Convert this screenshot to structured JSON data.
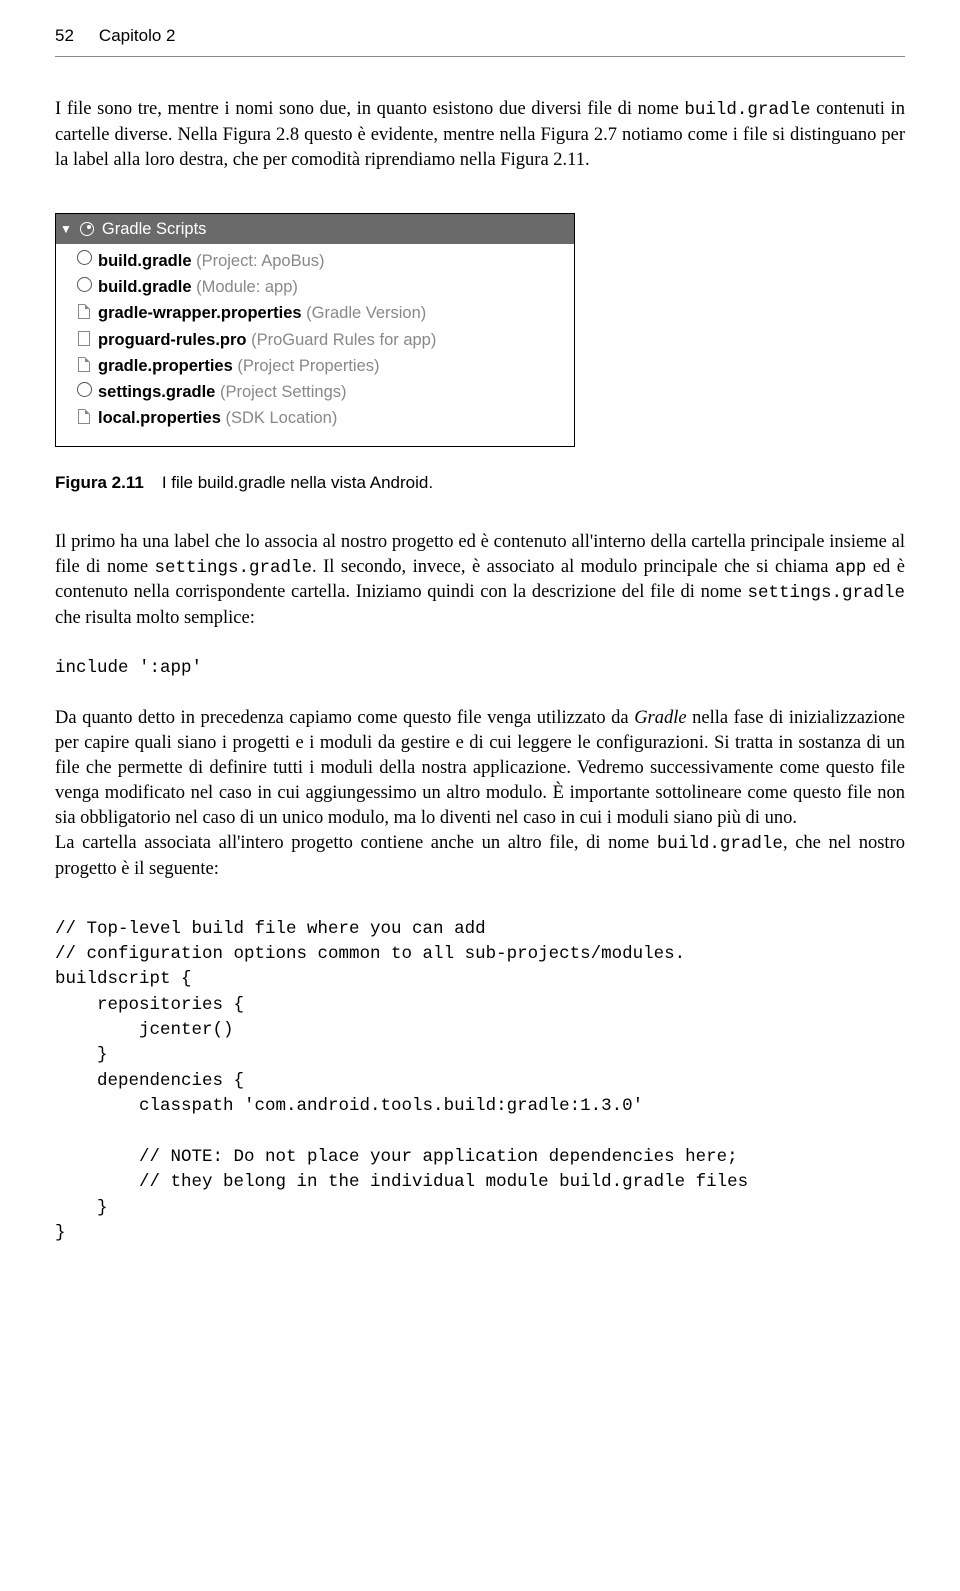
{
  "header": {
    "page": "52",
    "chapter": "Capitolo 2"
  },
  "para1_a": "I file sono tre, mentre i nomi sono due, in quanto esistono due diversi file di nome ",
  "para1_code1": "build.gradle",
  "para1_b": " contenuti in cartelle diverse. Nella Figura 2.8 questo è evidente, mentre nella Figura 2.7 notiamo come i file si distinguano per la label alla loro destra, che per comodità riprendiamo nella Figura 2.11.",
  "gs": {
    "title": "Gradle Scripts",
    "items": [
      {
        "name": "build.gradle",
        "suffix": " (Project: ApoBus)",
        "icon": "gradle"
      },
      {
        "name": "build.gradle",
        "suffix": " (Module: app)",
        "icon": "gradle"
      },
      {
        "name": "gradle-wrapper.properties",
        "suffix": " (Gradle Version)",
        "icon": "prop"
      },
      {
        "name": "proguard-rules.pro",
        "suffix": " (ProGuard Rules for app)",
        "icon": "text"
      },
      {
        "name": "gradle.properties",
        "suffix": " (Project Properties)",
        "icon": "prop"
      },
      {
        "name": "settings.gradle",
        "suffix": " (Project Settings)",
        "icon": "gradle"
      },
      {
        "name": "local.properties",
        "suffix": " (SDK Location)",
        "icon": "prop"
      }
    ]
  },
  "figcap": {
    "num": "Figura 2.11",
    "text": "I file build.gradle nella vista Android."
  },
  "para2_a": "Il primo ha una label che lo associa al nostro progetto ed è contenuto all'interno della cartella principale insieme al file di nome ",
  "para2_code1": "settings.gradle",
  "para2_b": ". Il secondo, invece, è associato al modulo principale che si chiama ",
  "para2_code2": "app",
  "para2_c": " ed è contenuto nella corrispondente cartella. Iniziamo quindi con la descrizione del file di nome ",
  "para2_code3": "settings.gradle",
  "para2_d": " che risulta molto semplice:",
  "code1": "include ':app'",
  "para3_a": "Da quanto detto in precedenza capiamo come questo file venga utilizzato da ",
  "para3_em": "Gradle",
  "para3_b": " nella fase di inizializzazione per capire quali siano i progetti e i moduli da gestire e di cui leggere le configurazioni. Si tratta in sostanza di un file che permette di definire tutti i moduli della nostra applicazione. Vedremo successivamente come questo file venga modificato nel caso in cui aggiungessimo un altro modulo. È importante sottolineare come questo file non sia obbligatorio nel caso di un unico modulo, ma lo diventi nel caso in cui i moduli siano più di uno.",
  "para4_a": "La cartella associata all'intero progetto contiene anche un altro file, di nome ",
  "para4_code1": "build.gradle",
  "para4_b": ", che nel nostro progetto è il seguente:",
  "code2": "// Top-level build file where you can add\n// configuration options common to all sub-projects/modules.\nbuildscript {\n    repositories {\n        jcenter()\n    }\n    dependencies {\n        classpath 'com.android.tools.build:gradle:1.3.0'\n\n        // NOTE: Do not place your application dependencies here;\n        // they belong in the individual module build.gradle files\n    }\n}"
}
